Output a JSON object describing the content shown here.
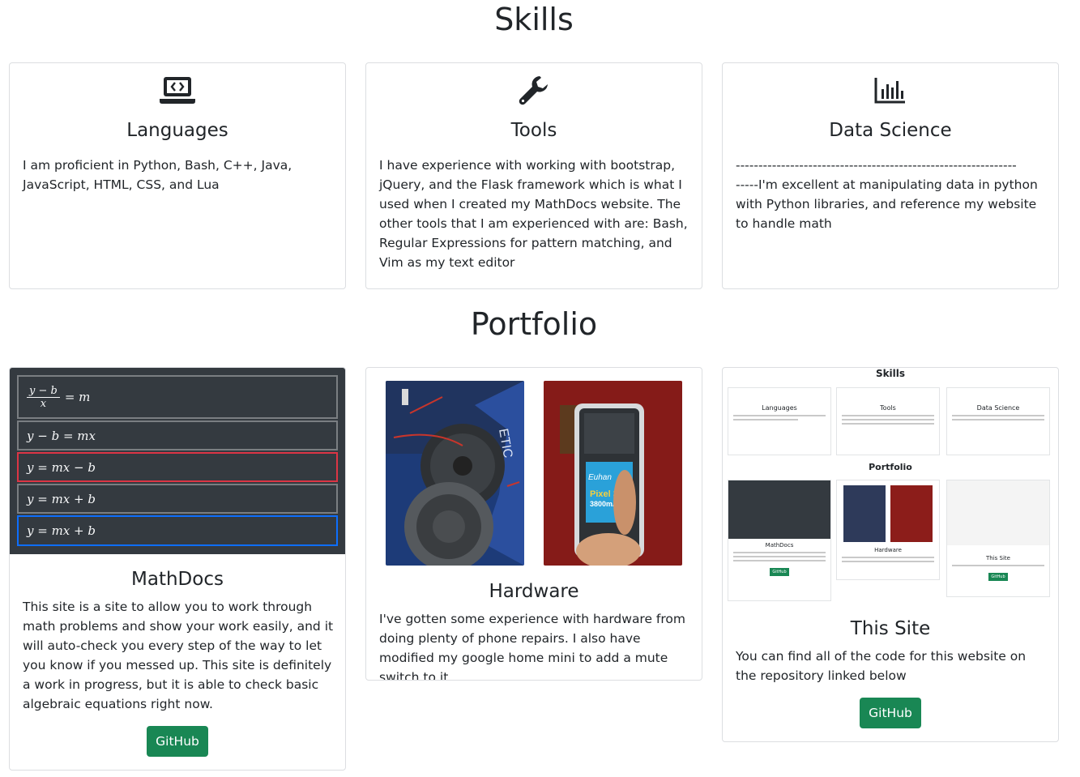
{
  "skills": {
    "title": "Skills",
    "cards": [
      {
        "icon": "laptop-code-icon",
        "title": "Languages",
        "text": "I am proficient in Python, Bash, C++, Java, JavaScript, HTML, CSS, and Lua"
      },
      {
        "icon": "wrench-icon",
        "title": "Tools",
        "text": "I have experience with working with bootstrap, jQuery, and the Flask framework which is what I used when I created my MathDocs website. The other tools that I am experienced with are: Bash, Regular Expressions for pattern matching, and Vim as my text editor"
      },
      {
        "icon": "bar-chart-icon",
        "title": "Data Science",
        "divider": "--------------------------------------------------------------",
        "text": "-----I'm excellent at manipulating data in python with Python libraries, and reference my website to handle math"
      }
    ]
  },
  "portfolio": {
    "title": "Portfolio",
    "cards": [
      {
        "title": "MathDocs",
        "text": "This site is a site to allow you to work through math problems and show your work easily, and it will auto-check you every step of the way to let you know if you messed up. This site is definitely a work in progress, but it is able to check basic algebraic equations right now.",
        "button": "GitHub",
        "equations": [
          "y − b = mx",
          "y = mx − b",
          "y = mx + b",
          "y = mx + b"
        ],
        "fraction": {
          "num": "y − b",
          "den": "x",
          "rhs": "= m"
        }
      },
      {
        "title": "Hardware",
        "text": "I've gotten some experience with hardware from doing plenty of phone repairs. I also have modified my google home mini to add a mute switch to it",
        "battery_brand": "Euhan",
        "battery_model": "Pixel 3",
        "battery_capacity": "3800mAh"
      },
      {
        "title": "This Site",
        "text": "You can find all of the code for this website on the repository linked below",
        "button": "GitHub",
        "thumbnail": {
          "skills_title": "Skills",
          "portfolio_title": "Portfolio",
          "skill_titles": [
            "Languages",
            "Tools",
            "Data Science"
          ],
          "port_titles": [
            "MathDocs",
            "Hardware",
            "This Site"
          ],
          "button": "GitHub"
        }
      }
    ]
  }
}
